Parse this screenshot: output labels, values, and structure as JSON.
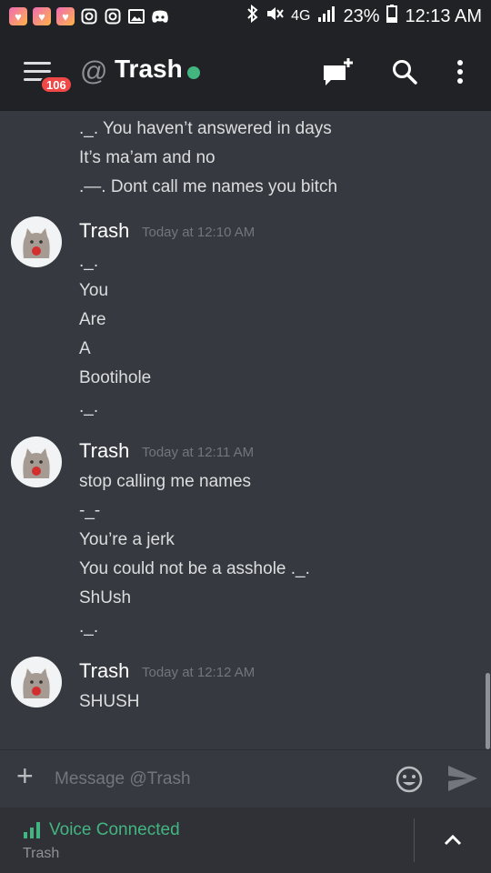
{
  "status_bar": {
    "battery": "23%",
    "time": "12:13 AM",
    "network": "4G",
    "icons": [
      "heart-app-icon",
      "heart-app-icon",
      "heart-app-icon",
      "instagram-icon",
      "instagram-icon",
      "gallery-icon",
      "discord-icon",
      "bluetooth-icon",
      "mute-icon",
      "signal-icon",
      "battery-icon"
    ]
  },
  "header": {
    "unread_count": "106",
    "channel_prefix": "@",
    "channel_name": "Trash",
    "status_color": "#43b581",
    "icons": [
      "menu-icon",
      "new-dm-icon",
      "search-icon",
      "overflow-menu-icon"
    ]
  },
  "messages": {
    "continued": [
      "._. You haven’t answered in days",
      "It’s ma’am and no",
      ".—. Dont call me names you bitch"
    ],
    "groups": [
      {
        "author": "Trash",
        "timestamp": "Today at 12:10 AM",
        "lines": [
          "._.",
          "You",
          "Are",
          "A",
          "Bootihole",
          "._."
        ]
      },
      {
        "author": "Trash",
        "timestamp": "Today at 12:11 AM",
        "lines": [
          "stop calling me names",
          "-_-",
          "You’re a jerk",
          "You could not be a asshole ._.",
          "ShUsh",
          "._."
        ]
      },
      {
        "author": "Trash",
        "timestamp": "Today at 12:12 AM",
        "lines": [
          "SHUSH"
        ]
      }
    ]
  },
  "composer": {
    "placeholder": "Message @Trash",
    "icons": [
      "add-attachment-icon",
      "emoji-icon",
      "send-icon"
    ]
  },
  "voice": {
    "title": "Voice Connected",
    "channel": "Trash",
    "accent": "#43b581"
  },
  "colors": {
    "background": "#36393f",
    "header": "#202225",
    "badge": "#f04747"
  }
}
